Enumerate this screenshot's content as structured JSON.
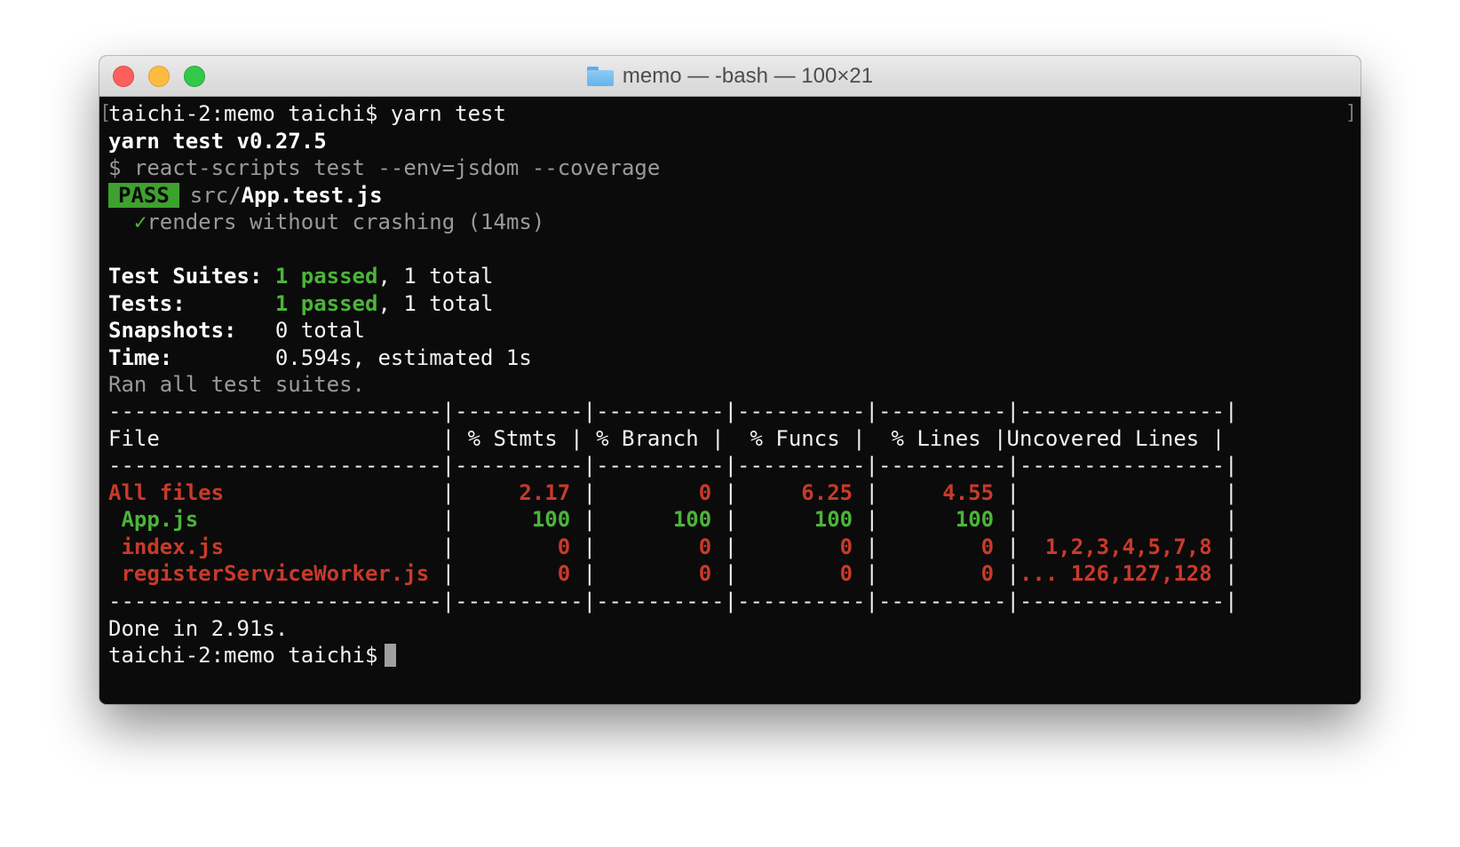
{
  "window": {
    "title": "memo — -bash — 100×21"
  },
  "terminal": {
    "prompt": "taichi-2:memo taichi$",
    "command": "yarn test",
    "yarn_header": "yarn test v0.27.5",
    "script_cmd": "$ react-scripts test --env=jsdom --coverage",
    "pass_badge": "PASS",
    "test_file_dir": "src/",
    "test_file_name": "App.test.js",
    "test_checkmark": "✓",
    "test_case": "renders without crashing (14ms)",
    "summary": {
      "suites_label": "Test Suites:",
      "suites_passed": "1 passed",
      "suites_total": ", 1 total",
      "tests_label": "Tests:",
      "tests_passed": "1 passed",
      "tests_total": ", 1 total",
      "snapshots_label": "Snapshots:",
      "snapshots_value": "0 total",
      "time_label": "Time:",
      "time_value": "0.594s, estimated 1s",
      "ran_all": "Ran all test suites."
    },
    "coverage": {
      "separator": "--------------------------|----------|----------|----------|----------|----------------|",
      "header": {
        "file": "File                      |",
        "stmts": " % Stmts |",
        "branch": " % Branch |",
        "funcs": "  % Funcs |",
        "lines": "  % Lines |",
        "uncovered": "Uncovered Lines |"
      },
      "rows": [
        {
          "file": "All files",
          "stmts": "2.17",
          "branch": "0",
          "funcs": "6.25",
          "lines": "4.55",
          "uncovered": ""
        },
        {
          "file": " App.js",
          "stmts": "100",
          "branch": "100",
          "funcs": "100",
          "lines": "100",
          "uncovered": ""
        },
        {
          "file": " index.js",
          "stmts": "0",
          "branch": "0",
          "funcs": "0",
          "lines": "0",
          "uncovered": "1,2,3,4,5,7,8"
        },
        {
          "file": " registerServiceWorker.js",
          "stmts": "0",
          "branch": "0",
          "funcs": "0",
          "lines": "0",
          "uncovered": "... 126,127,128"
        }
      ]
    },
    "done": "Done in 2.91s.",
    "final_prompt": "taichi-2:memo taichi$"
  }
}
